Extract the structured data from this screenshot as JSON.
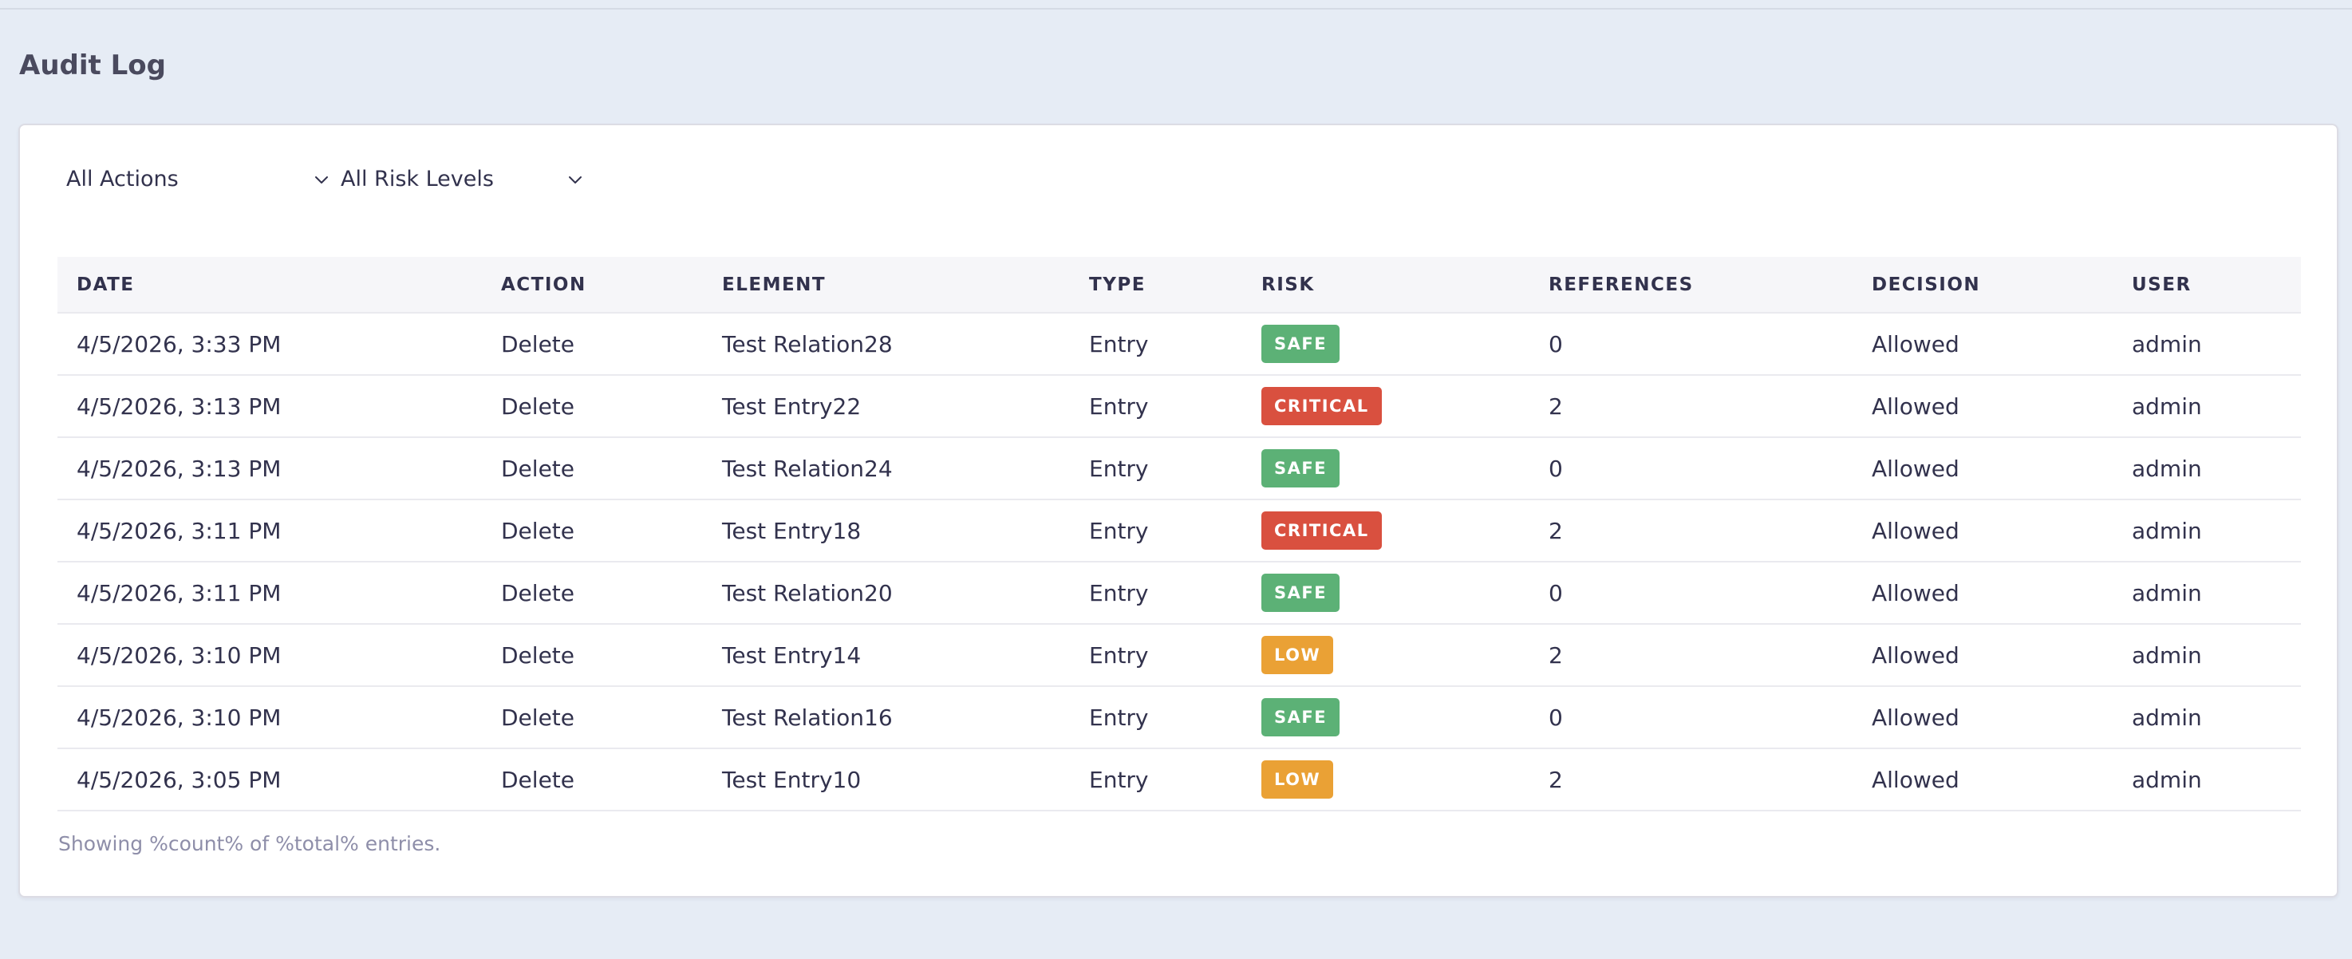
{
  "page": {
    "title": "Audit Log"
  },
  "filters": {
    "actions": "All Actions",
    "risk_levels": "All Risk Levels"
  },
  "table": {
    "columns": [
      "DATE",
      "ACTION",
      "ELEMENT",
      "TYPE",
      "RISK",
      "REFERENCES",
      "DECISION",
      "USER"
    ],
    "rows": [
      {
        "date": "4/5/2026, 3:33 PM",
        "action": "Delete",
        "element": "Test Relation28",
        "type": "Entry",
        "risk": "SAFE",
        "references": "0",
        "decision": "Allowed",
        "user": "admin"
      },
      {
        "date": "4/5/2026, 3:13 PM",
        "action": "Delete",
        "element": "Test Entry22",
        "type": "Entry",
        "risk": "CRITICAL",
        "references": "2",
        "decision": "Allowed",
        "user": "admin"
      },
      {
        "date": "4/5/2026, 3:13 PM",
        "action": "Delete",
        "element": "Test Relation24",
        "type": "Entry",
        "risk": "SAFE",
        "references": "0",
        "decision": "Allowed",
        "user": "admin"
      },
      {
        "date": "4/5/2026, 3:11 PM",
        "action": "Delete",
        "element": "Test Entry18",
        "type": "Entry",
        "risk": "CRITICAL",
        "references": "2",
        "decision": "Allowed",
        "user": "admin"
      },
      {
        "date": "4/5/2026, 3:11 PM",
        "action": "Delete",
        "element": "Test Relation20",
        "type": "Entry",
        "risk": "SAFE",
        "references": "0",
        "decision": "Allowed",
        "user": "admin"
      },
      {
        "date": "4/5/2026, 3:10 PM",
        "action": "Delete",
        "element": "Test Entry14",
        "type": "Entry",
        "risk": "LOW",
        "references": "2",
        "decision": "Allowed",
        "user": "admin"
      },
      {
        "date": "4/5/2026, 3:10 PM",
        "action": "Delete",
        "element": "Test Relation16",
        "type": "Entry",
        "risk": "SAFE",
        "references": "0",
        "decision": "Allowed",
        "user": "admin"
      },
      {
        "date": "4/5/2026, 3:05 PM",
        "action": "Delete",
        "element": "Test Entry10",
        "type": "Entry",
        "risk": "LOW",
        "references": "2",
        "decision": "Allowed",
        "user": "admin"
      }
    ]
  },
  "footer": {
    "note": "Showing %count% of %total% entries."
  },
  "colors": {
    "safe": "#5cb176",
    "critical": "#d9503f",
    "low": "#eaa135"
  },
  "icons": {
    "select_arrow": "chevron-down-icon"
  }
}
